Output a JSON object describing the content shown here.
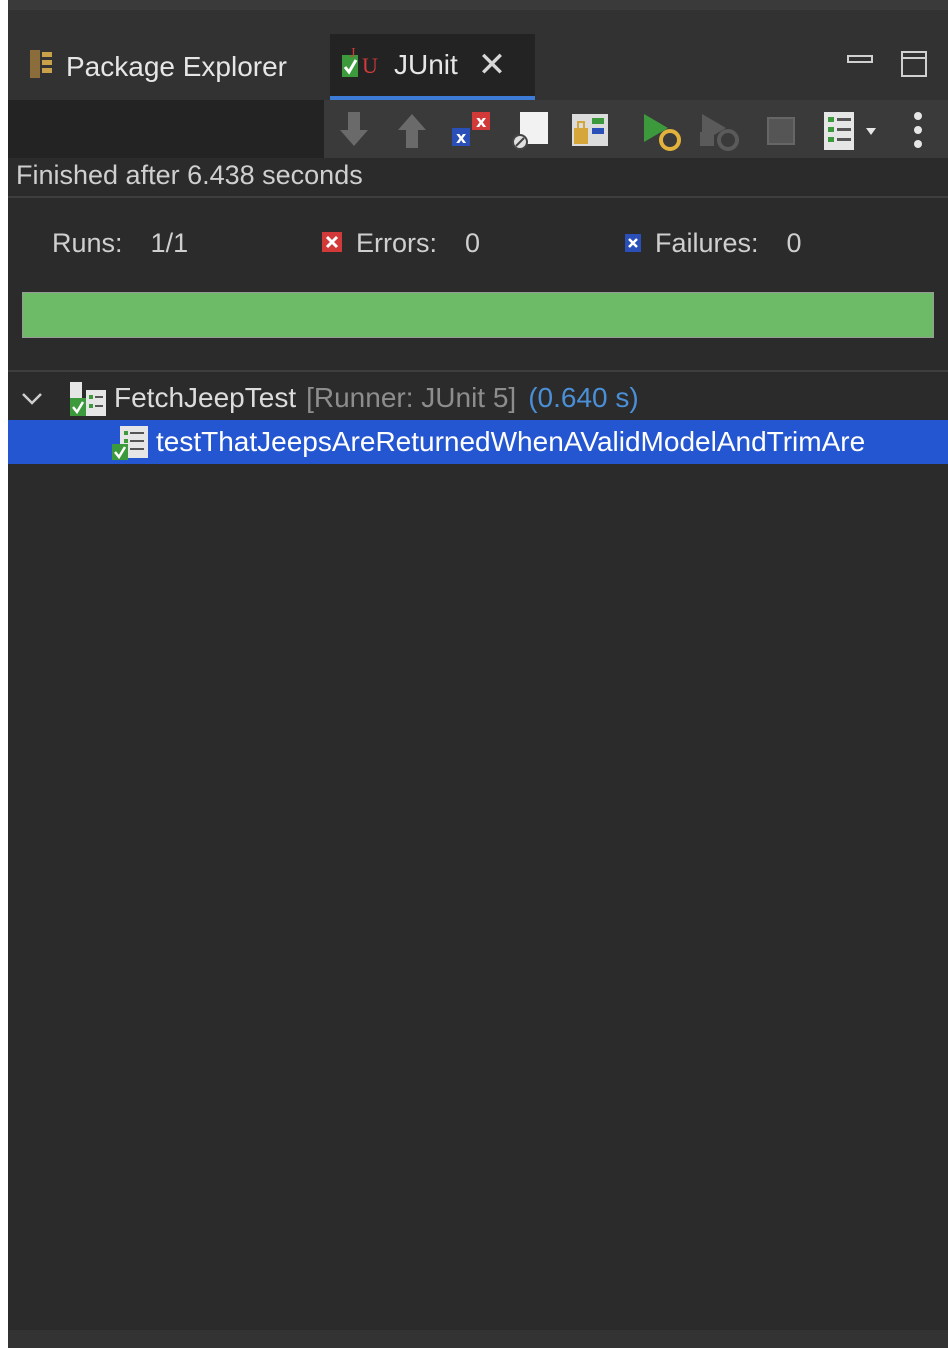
{
  "tabs": {
    "package_explorer": "Package Explorer",
    "junit": "JUnit"
  },
  "status": {
    "finished": "Finished after 6.438 seconds"
  },
  "counters": {
    "runs_label": "Runs:",
    "runs_value": "1/1",
    "errors_label": "Errors:",
    "errors_value": "0",
    "failures_label": "Failures:",
    "failures_value": "0"
  },
  "progress": {
    "fraction": 1.0,
    "color": "#6dbb66"
  },
  "tree": {
    "suite": {
      "name": "FetchJeepTest",
      "runner": "[Runner: JUnit 5]",
      "time": "(0.640 s)"
    },
    "test": {
      "name": "testThatJeepsAreReturnedWhenAValidModelAndTrimAre"
    }
  },
  "colors": {
    "accent": "#3c7bd6",
    "selection": "#2556d1",
    "error_red": "#d23a3a",
    "failure_blue": "#2a4fb8",
    "time_blue": "#4a8fd8"
  },
  "icons": {
    "package_explorer": "package-explorer-icon",
    "junit": "junit-icon",
    "close": "close-icon",
    "minimize": "minimize-icon",
    "maximize": "maximize-icon",
    "next_failure": "arrow-down-icon",
    "prev_failure": "arrow-up-icon",
    "show_failures_only": "failures-only-icon",
    "scroll_lock": "scroll-lock-icon",
    "history": "history-icon",
    "rerun": "rerun-icon",
    "rerun_failed_first": "rerun-failed-icon",
    "stop": "stop-icon",
    "layout": "layout-menu-icon",
    "view_menu": "kebab-menu-icon"
  }
}
